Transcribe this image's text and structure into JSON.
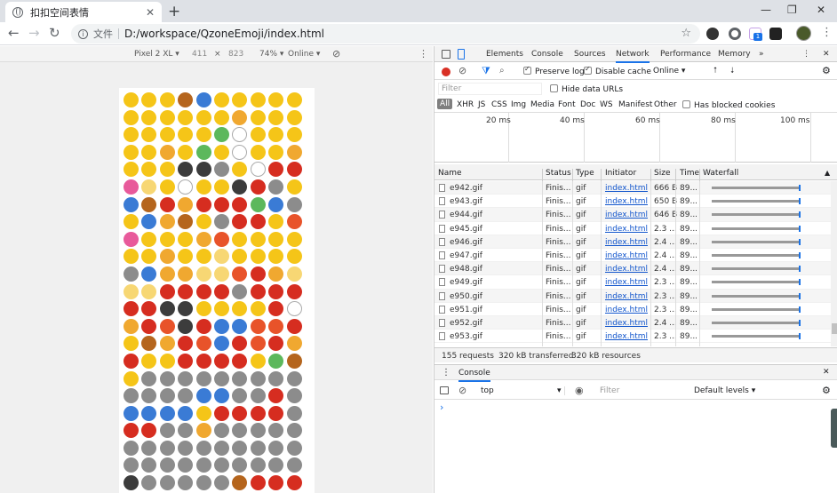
{
  "browser": {
    "tab_title": "扣扣空间表情",
    "tab_close": "✕",
    "new_tab": "+",
    "window": {
      "minimize": "—",
      "restore": "❐",
      "close": "✕"
    },
    "nav": {
      "back": "←",
      "forward": "→",
      "reload": "↻"
    },
    "address": {
      "scheme_label": "文件",
      "url": "D:/workspace/QzoneEmoji/index.html",
      "star": "☆"
    },
    "extension_badge": "1",
    "menu": "⋮"
  },
  "device_toolbar": {
    "device": "Pixel 2 XL ▾",
    "width": "411",
    "times": "×",
    "height": "823",
    "zoom": "74% ▾",
    "throttle": "Online ▾",
    "rotate_icon": "⊘",
    "more": "⋮"
  },
  "devtools": {
    "tabs": [
      "Elements",
      "Console",
      "Sources",
      "Network",
      "Performance",
      "Memory"
    ],
    "active_tab": "Network",
    "more_tabs": "»",
    "menu": "⋮",
    "close": "✕",
    "controls": {
      "preserve_log": "Preserve log",
      "disable_cache": "Disable cache",
      "online": "Online",
      "dropdown_glyph": "▾",
      "upload": "⭡",
      "download": "⭣",
      "gear": "⚙"
    },
    "filter": {
      "placeholder": "Filter",
      "hide_data_urls": "Hide data URLs"
    },
    "types": [
      "All",
      "XHR",
      "JS",
      "CSS",
      "Img",
      "Media",
      "Font",
      "Doc",
      "WS",
      "Manifest",
      "Other"
    ],
    "blocked_cookies": "Has blocked cookies",
    "timeline_ticks": [
      "20 ms",
      "40 ms",
      "60 ms",
      "80 ms",
      "100 ms"
    ],
    "columns": [
      "Name",
      "Status",
      "Type",
      "Initiator",
      "Size",
      "Time",
      "Waterfall"
    ],
    "sort_glyph": "▲",
    "rows": [
      {
        "name": "e942.gif",
        "status": "Finis...",
        "type": "gif",
        "initiator": "index.html",
        "size": "666 B",
        "time": "89..."
      },
      {
        "name": "e943.gif",
        "status": "Finis...",
        "type": "gif",
        "initiator": "index.html",
        "size": "650 B",
        "time": "89..."
      },
      {
        "name": "e944.gif",
        "status": "Finis...",
        "type": "gif",
        "initiator": "index.html",
        "size": "646 B",
        "time": "89..."
      },
      {
        "name": "e945.gif",
        "status": "Finis...",
        "type": "gif",
        "initiator": "index.html",
        "size": "2.3 ...",
        "time": "89..."
      },
      {
        "name": "e946.gif",
        "status": "Finis...",
        "type": "gif",
        "initiator": "index.html",
        "size": "2.4 ...",
        "time": "89..."
      },
      {
        "name": "e947.gif",
        "status": "Finis...",
        "type": "gif",
        "initiator": "index.html",
        "size": "2.4 ...",
        "time": "89..."
      },
      {
        "name": "e948.gif",
        "status": "Finis...",
        "type": "gif",
        "initiator": "index.html",
        "size": "2.4 ...",
        "time": "89..."
      },
      {
        "name": "e949.gif",
        "status": "Finis...",
        "type": "gif",
        "initiator": "index.html",
        "size": "2.3 ...",
        "time": "89..."
      },
      {
        "name": "e950.gif",
        "status": "Finis...",
        "type": "gif",
        "initiator": "index.html",
        "size": "2.3 ...",
        "time": "89..."
      },
      {
        "name": "e951.gif",
        "status": "Finis...",
        "type": "gif",
        "initiator": "index.html",
        "size": "2.3 ...",
        "time": "89..."
      },
      {
        "name": "e952.gif",
        "status": "Finis...",
        "type": "gif",
        "initiator": "index.html",
        "size": "2.4 ...",
        "time": "89..."
      },
      {
        "name": "e953.gif",
        "status": "Finis...",
        "type": "gif",
        "initiator": "index.html",
        "size": "2.3 ...",
        "time": "89..."
      }
    ],
    "summary": {
      "requests": "155 requests",
      "transferred": "320 kB transferred",
      "resources": "320 kB resources"
    },
    "drawer": {
      "tab": "Console",
      "context": "top",
      "filter_placeholder": "Filter",
      "levels": "Default levels ▾",
      "prompt": "›"
    }
  },
  "colors": {
    "accent": "#1a73e8",
    "record": "#d93025",
    "emoji_palette": [
      "#f5c518",
      "#f0a830",
      "#e8532a",
      "#d62d20",
      "#3a7bd5",
      "#8c8c8c",
      "#3c3c3c",
      "#e85a9b",
      "#5cb85c",
      "#f7d774",
      "#b5651d",
      "#ffffff"
    ]
  }
}
